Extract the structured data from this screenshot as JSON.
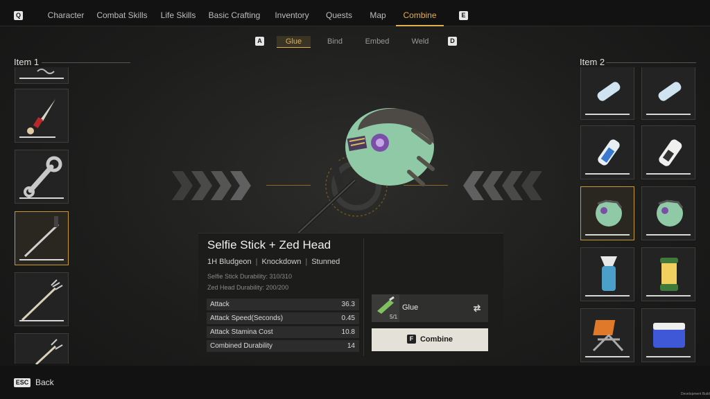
{
  "nav": {
    "left_key": "Q",
    "right_key": "E",
    "tabs": [
      "Character",
      "Combat Skills",
      "Life Skills",
      "Basic Crafting",
      "Inventory",
      "Quests",
      "Map",
      "Combine"
    ],
    "active_tab": "Combine"
  },
  "subnav": {
    "left_key": "A",
    "right_key": "D",
    "tabs": [
      "Glue",
      "Bind",
      "Embed",
      "Weld"
    ],
    "active_tab": "Glue"
  },
  "item1": {
    "title": "Item 1",
    "slots": [
      {
        "icon": "rope-icon",
        "durability": 1.0
      },
      {
        "icon": "knife-icon",
        "durability": 0.75
      },
      {
        "icon": "wrench-icon",
        "durability": 1.0
      },
      {
        "icon": "selfie-stick-icon",
        "durability": 1.0,
        "selected": true
      },
      {
        "icon": "pitchfork-icon",
        "durability": 1.0
      },
      {
        "icon": "pitchfork-icon",
        "durability": 1.0
      }
    ]
  },
  "item2": {
    "title": "Item 2",
    "slots": [
      {
        "icon": "water-bottle-icon"
      },
      {
        "icon": "water-bottle-icon"
      },
      {
        "icon": "water-bottle-icon"
      },
      {
        "icon": "milk-bottle-icon"
      },
      {
        "icon": "zed-head-icon",
        "selected": true
      },
      {
        "icon": "zed-head-icon"
      },
      {
        "icon": "water-filter-icon"
      },
      {
        "icon": "lantern-icon"
      },
      {
        "icon": "folding-chair-icon"
      },
      {
        "icon": "cooler-icon"
      }
    ]
  },
  "result": {
    "name": "Selfie Stick + Zed Head",
    "tags": [
      "1H Bludgeon",
      "Knockdown",
      "Stunned"
    ],
    "durability_lines": [
      "Selfie Stick Durability: 310/310",
      "Zed Head Durability: 200/200"
    ],
    "stats": [
      {
        "label": "Attack",
        "value": "36.3"
      },
      {
        "label": "Attack Speed(Seconds)",
        "value": "0.45"
      },
      {
        "label": "Attack Stamina Cost",
        "value": "10.8"
      },
      {
        "label": "Combined Durability",
        "value": "14"
      }
    ]
  },
  "material": {
    "name": "Glue",
    "count": "5/1",
    "icon": "glue-tube-icon",
    "swap_icon": "swap-icon"
  },
  "combine": {
    "key": "F",
    "label": "Combine"
  },
  "back": {
    "key": "ESC",
    "label": "Back"
  },
  "build_label": "Development Build",
  "colors": {
    "accent": "#e3b04b",
    "zed_skin": "#8fc9a5"
  }
}
